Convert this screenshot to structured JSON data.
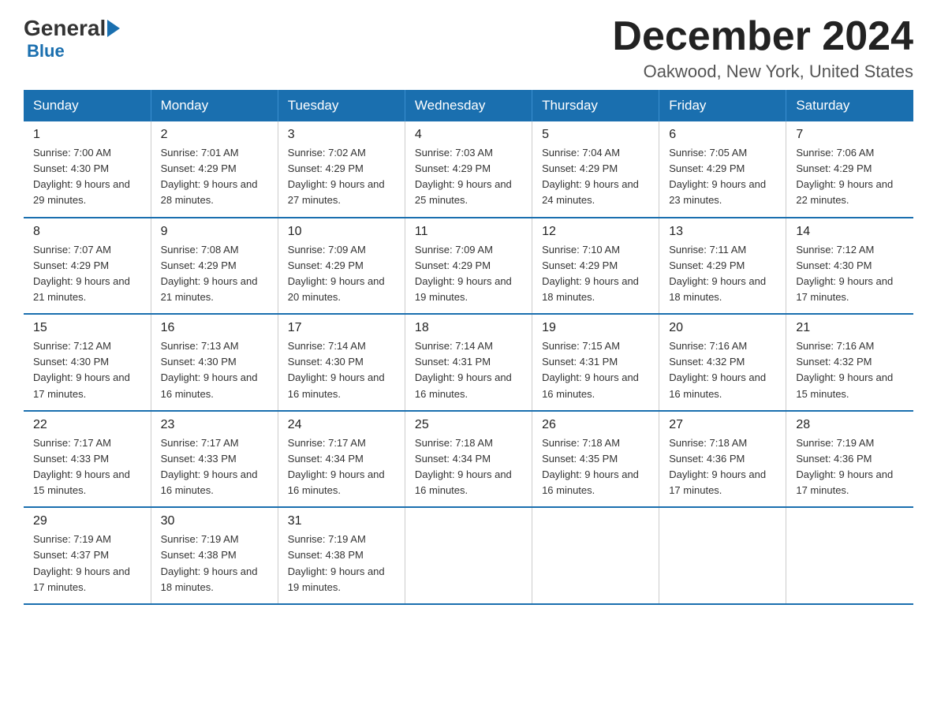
{
  "header": {
    "logo": {
      "general": "General",
      "blue": "Blue"
    },
    "title": "December 2024",
    "location": "Oakwood, New York, United States"
  },
  "calendar": {
    "days_of_week": [
      "Sunday",
      "Monday",
      "Tuesday",
      "Wednesday",
      "Thursday",
      "Friday",
      "Saturday"
    ],
    "weeks": [
      [
        {
          "day": "1",
          "sunrise": "Sunrise: 7:00 AM",
          "sunset": "Sunset: 4:30 PM",
          "daylight": "Daylight: 9 hours and 29 minutes."
        },
        {
          "day": "2",
          "sunrise": "Sunrise: 7:01 AM",
          "sunset": "Sunset: 4:29 PM",
          "daylight": "Daylight: 9 hours and 28 minutes."
        },
        {
          "day": "3",
          "sunrise": "Sunrise: 7:02 AM",
          "sunset": "Sunset: 4:29 PM",
          "daylight": "Daylight: 9 hours and 27 minutes."
        },
        {
          "day": "4",
          "sunrise": "Sunrise: 7:03 AM",
          "sunset": "Sunset: 4:29 PM",
          "daylight": "Daylight: 9 hours and 25 minutes."
        },
        {
          "day": "5",
          "sunrise": "Sunrise: 7:04 AM",
          "sunset": "Sunset: 4:29 PM",
          "daylight": "Daylight: 9 hours and 24 minutes."
        },
        {
          "day": "6",
          "sunrise": "Sunrise: 7:05 AM",
          "sunset": "Sunset: 4:29 PM",
          "daylight": "Daylight: 9 hours and 23 minutes."
        },
        {
          "day": "7",
          "sunrise": "Sunrise: 7:06 AM",
          "sunset": "Sunset: 4:29 PM",
          "daylight": "Daylight: 9 hours and 22 minutes."
        }
      ],
      [
        {
          "day": "8",
          "sunrise": "Sunrise: 7:07 AM",
          "sunset": "Sunset: 4:29 PM",
          "daylight": "Daylight: 9 hours and 21 minutes."
        },
        {
          "day": "9",
          "sunrise": "Sunrise: 7:08 AM",
          "sunset": "Sunset: 4:29 PM",
          "daylight": "Daylight: 9 hours and 21 minutes."
        },
        {
          "day": "10",
          "sunrise": "Sunrise: 7:09 AM",
          "sunset": "Sunset: 4:29 PM",
          "daylight": "Daylight: 9 hours and 20 minutes."
        },
        {
          "day": "11",
          "sunrise": "Sunrise: 7:09 AM",
          "sunset": "Sunset: 4:29 PM",
          "daylight": "Daylight: 9 hours and 19 minutes."
        },
        {
          "day": "12",
          "sunrise": "Sunrise: 7:10 AM",
          "sunset": "Sunset: 4:29 PM",
          "daylight": "Daylight: 9 hours and 18 minutes."
        },
        {
          "day": "13",
          "sunrise": "Sunrise: 7:11 AM",
          "sunset": "Sunset: 4:29 PM",
          "daylight": "Daylight: 9 hours and 18 minutes."
        },
        {
          "day": "14",
          "sunrise": "Sunrise: 7:12 AM",
          "sunset": "Sunset: 4:30 PM",
          "daylight": "Daylight: 9 hours and 17 minutes."
        }
      ],
      [
        {
          "day": "15",
          "sunrise": "Sunrise: 7:12 AM",
          "sunset": "Sunset: 4:30 PM",
          "daylight": "Daylight: 9 hours and 17 minutes."
        },
        {
          "day": "16",
          "sunrise": "Sunrise: 7:13 AM",
          "sunset": "Sunset: 4:30 PM",
          "daylight": "Daylight: 9 hours and 16 minutes."
        },
        {
          "day": "17",
          "sunrise": "Sunrise: 7:14 AM",
          "sunset": "Sunset: 4:30 PM",
          "daylight": "Daylight: 9 hours and 16 minutes."
        },
        {
          "day": "18",
          "sunrise": "Sunrise: 7:14 AM",
          "sunset": "Sunset: 4:31 PM",
          "daylight": "Daylight: 9 hours and 16 minutes."
        },
        {
          "day": "19",
          "sunrise": "Sunrise: 7:15 AM",
          "sunset": "Sunset: 4:31 PM",
          "daylight": "Daylight: 9 hours and 16 minutes."
        },
        {
          "day": "20",
          "sunrise": "Sunrise: 7:16 AM",
          "sunset": "Sunset: 4:32 PM",
          "daylight": "Daylight: 9 hours and 16 minutes."
        },
        {
          "day": "21",
          "sunrise": "Sunrise: 7:16 AM",
          "sunset": "Sunset: 4:32 PM",
          "daylight": "Daylight: 9 hours and 15 minutes."
        }
      ],
      [
        {
          "day": "22",
          "sunrise": "Sunrise: 7:17 AM",
          "sunset": "Sunset: 4:33 PM",
          "daylight": "Daylight: 9 hours and 15 minutes."
        },
        {
          "day": "23",
          "sunrise": "Sunrise: 7:17 AM",
          "sunset": "Sunset: 4:33 PM",
          "daylight": "Daylight: 9 hours and 16 minutes."
        },
        {
          "day": "24",
          "sunrise": "Sunrise: 7:17 AM",
          "sunset": "Sunset: 4:34 PM",
          "daylight": "Daylight: 9 hours and 16 minutes."
        },
        {
          "day": "25",
          "sunrise": "Sunrise: 7:18 AM",
          "sunset": "Sunset: 4:34 PM",
          "daylight": "Daylight: 9 hours and 16 minutes."
        },
        {
          "day": "26",
          "sunrise": "Sunrise: 7:18 AM",
          "sunset": "Sunset: 4:35 PM",
          "daylight": "Daylight: 9 hours and 16 minutes."
        },
        {
          "day": "27",
          "sunrise": "Sunrise: 7:18 AM",
          "sunset": "Sunset: 4:36 PM",
          "daylight": "Daylight: 9 hours and 17 minutes."
        },
        {
          "day": "28",
          "sunrise": "Sunrise: 7:19 AM",
          "sunset": "Sunset: 4:36 PM",
          "daylight": "Daylight: 9 hours and 17 minutes."
        }
      ],
      [
        {
          "day": "29",
          "sunrise": "Sunrise: 7:19 AM",
          "sunset": "Sunset: 4:37 PM",
          "daylight": "Daylight: 9 hours and 17 minutes."
        },
        {
          "day": "30",
          "sunrise": "Sunrise: 7:19 AM",
          "sunset": "Sunset: 4:38 PM",
          "daylight": "Daylight: 9 hours and 18 minutes."
        },
        {
          "day": "31",
          "sunrise": "Sunrise: 7:19 AM",
          "sunset": "Sunset: 4:38 PM",
          "daylight": "Daylight: 9 hours and 19 minutes."
        },
        null,
        null,
        null,
        null
      ]
    ]
  }
}
